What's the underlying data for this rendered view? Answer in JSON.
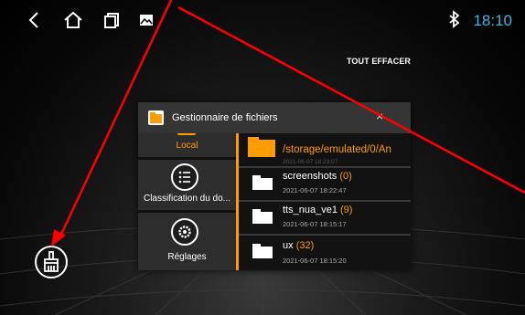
{
  "status_bar": {
    "back_icon": "chevron-left-icon",
    "home_icon": "home-icon",
    "recents_icon": "recents-icon",
    "gallery_icon": "image-icon",
    "bluetooth_icon": "bluetooth-icon",
    "time": "18:10",
    "time_color": "#3ab6e8"
  },
  "clear_all": "TOUT EFFACER",
  "recent_card": {
    "title": "Gestionnaire de fichiers",
    "close": "×",
    "sidebar": [
      {
        "label": "Local",
        "icon": "folder-icon",
        "selected": true
      },
      {
        "label": "Classification du do...",
        "icon": "list-icon"
      },
      {
        "label": "Réglages",
        "icon": "gear-icon"
      }
    ],
    "path": "/storage/emulated/0/An",
    "files": [
      {
        "name": "screenshots",
        "count": "(0)",
        "date": "2021-06-07 18:22:47"
      },
      {
        "name": "tts_nua_ve1",
        "count": "(9)",
        "date": "2021-06-07 18:15:17"
      },
      {
        "name": "ux",
        "count": "(32)",
        "date": "2021-06-07 18:15:20"
      }
    ],
    "partial_date": "2021-06-07 18:23:07",
    "accent_color": "#ff9c00"
  },
  "clean_button_icon": "broom-icon",
  "annotation_color": "#ff0000"
}
